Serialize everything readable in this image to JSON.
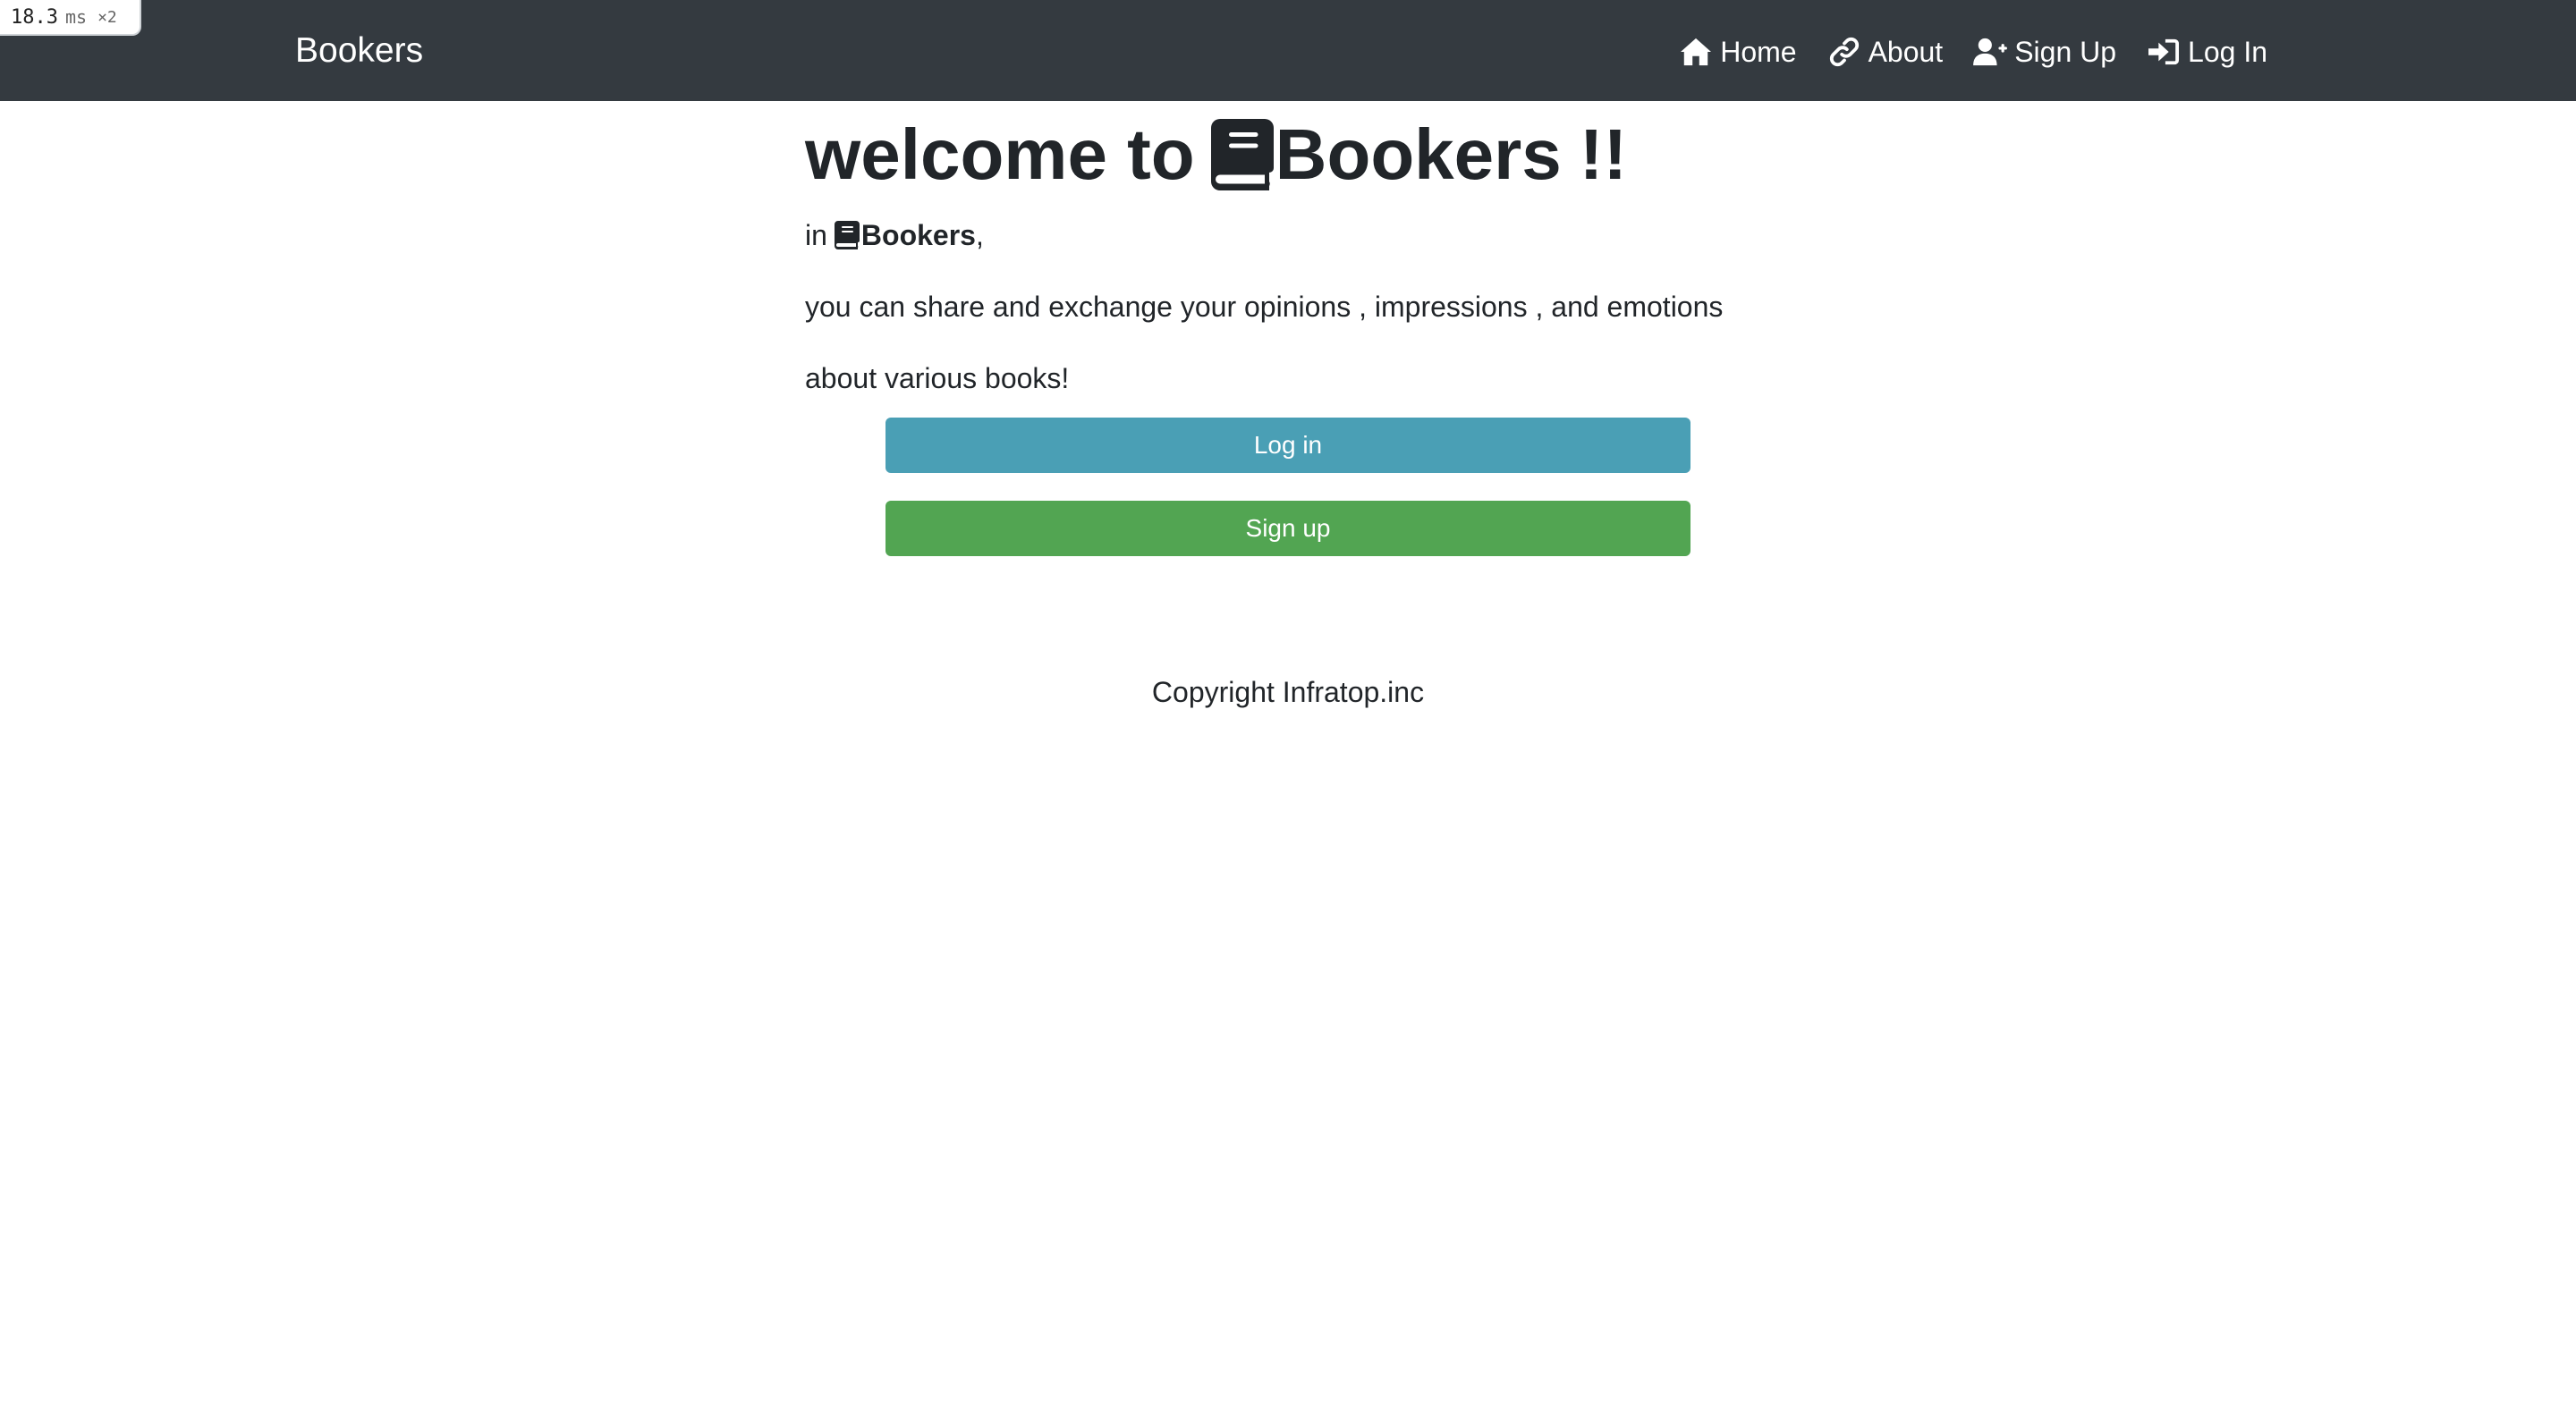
{
  "perf": {
    "value": "18.3",
    "unit": "ms",
    "multiplier": "×2"
  },
  "navbar": {
    "brand": "Bookers",
    "links": [
      {
        "label": "Home",
        "icon": "home-icon"
      },
      {
        "label": "About",
        "icon": "link-icon"
      },
      {
        "label": "Sign Up",
        "icon": "user-plus-icon"
      },
      {
        "label": "Log In",
        "icon": "sign-in-icon"
      }
    ],
    "background": "#343a40"
  },
  "main": {
    "title_prefix": "welcome to",
    "title_brand": "Bookers",
    "title_suffix": "!!",
    "line1_prefix": "in",
    "line1_brand": "Bookers",
    "line1_suffix": ",",
    "line2": "you can share and exchange your opinions , impressions , and emotions",
    "line3": "about various books!",
    "login_button": "Log in",
    "signup_button": "Sign up",
    "login_color": "#4a9fb5",
    "signup_color": "#52a552"
  },
  "footer": {
    "copyright": "Copyright Infratop.inc"
  }
}
